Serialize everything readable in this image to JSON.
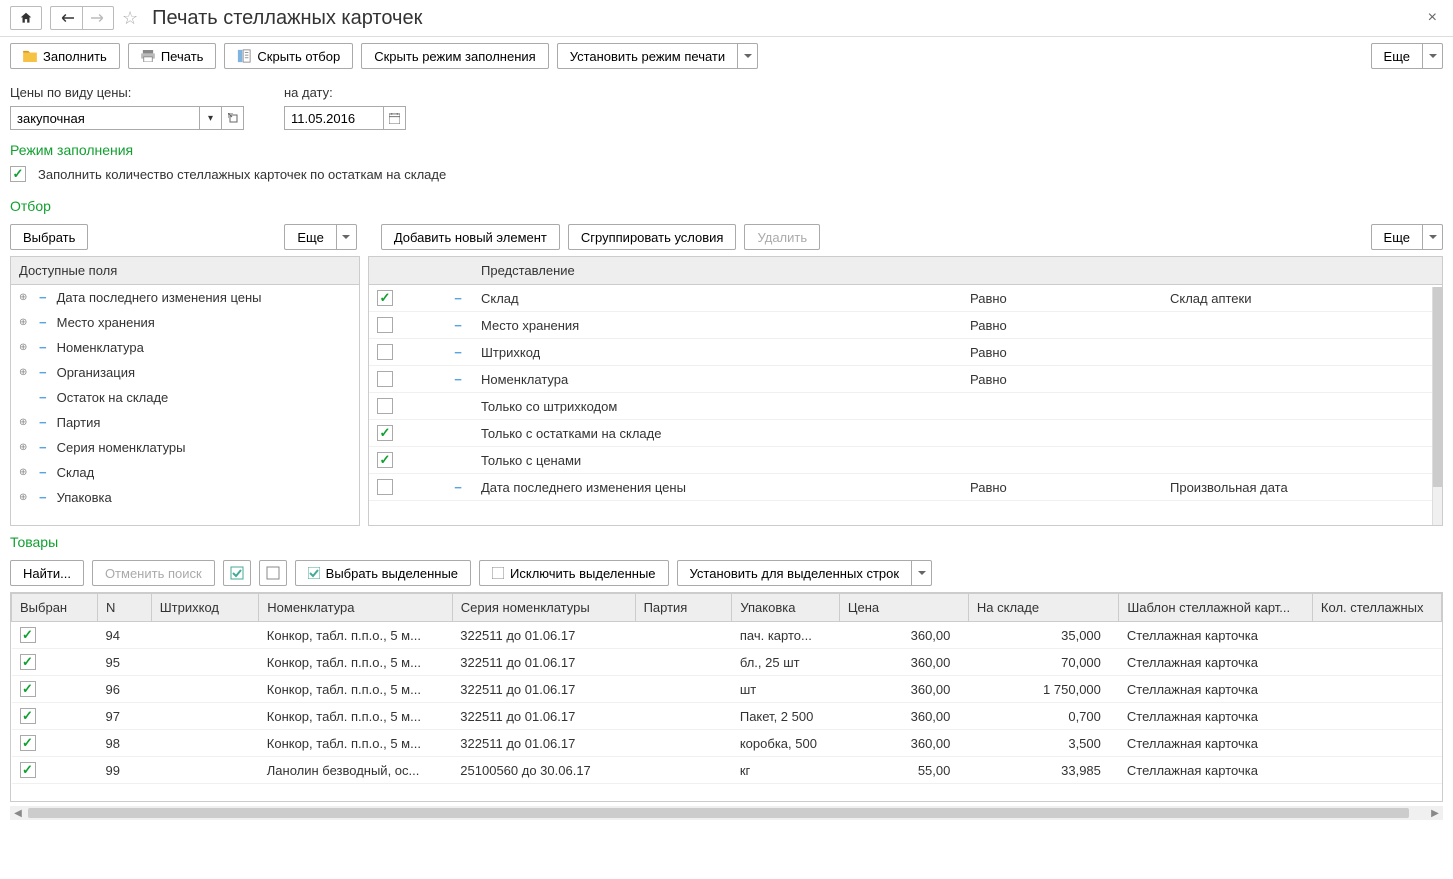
{
  "header": {
    "title": "Печать стеллажных карточек"
  },
  "toolbar": {
    "fill_label": "Заполнить",
    "print_label": "Печать",
    "hide_filter_label": "Скрыть отбор",
    "hide_fill_mode_label": "Скрыть режим заполнения",
    "set_print_mode_label": "Установить режим печати",
    "more_label": "Еще"
  },
  "form": {
    "price_type_label": "Цены по виду цены:",
    "price_type_value": "закупочная",
    "date_label": "на дату:",
    "date_value": "11.05.2016"
  },
  "fill_mode": {
    "title": "Режим заполнения",
    "checkbox_label": "Заполнить количество стеллажных карточек по остаткам на складе"
  },
  "filter": {
    "title": "Отбор",
    "select_label": "Выбрать",
    "more_label": "Еще",
    "add_element_label": "Добавить новый элемент",
    "group_conditions_label": "Сгруппировать условия",
    "delete_label": "Удалить",
    "more2_label": "Еще",
    "available_fields_header": "Доступные поля",
    "representation_header": "Представление",
    "fields": [
      {
        "expand": true,
        "label": "Дата последнего изменения цены"
      },
      {
        "expand": true,
        "label": "Место хранения"
      },
      {
        "expand": true,
        "label": "Номенклатура"
      },
      {
        "expand": true,
        "label": "Организация"
      },
      {
        "expand": false,
        "label": "Остаток на складе"
      },
      {
        "expand": true,
        "label": "Партия"
      },
      {
        "expand": true,
        "label": "Серия номенклатуры"
      },
      {
        "expand": true,
        "label": "Склад"
      },
      {
        "expand": true,
        "label": "Упаковка"
      }
    ],
    "rows": [
      {
        "checked": true,
        "has_minus": true,
        "name": "Склад",
        "op": "Равно",
        "val": "Склад аптеки"
      },
      {
        "checked": false,
        "has_minus": true,
        "name": "Место хранения",
        "op": "Равно",
        "val": ""
      },
      {
        "checked": false,
        "has_minus": true,
        "name": "Штрихкод",
        "op": "Равно",
        "val": ""
      },
      {
        "checked": false,
        "has_minus": true,
        "name": "Номенклатура",
        "op": "Равно",
        "val": ""
      },
      {
        "checked": false,
        "has_minus": false,
        "name": "Только со штрихкодом",
        "op": "",
        "val": ""
      },
      {
        "checked": true,
        "has_minus": false,
        "name": "Только с остатками на складе",
        "op": "",
        "val": ""
      },
      {
        "checked": true,
        "has_minus": false,
        "name": "Только с ценами",
        "op": "",
        "val": ""
      },
      {
        "checked": false,
        "has_minus": true,
        "name": "Дата последнего изменения цены",
        "op": "Равно",
        "val": "Произвольная дата"
      }
    ]
  },
  "products": {
    "title": "Товары",
    "find_label": "Найти...",
    "cancel_search_label": "Отменить поиск",
    "select_marked_label": "Выбрать выделенные",
    "exclude_marked_label": "Исключить выделенные",
    "set_for_marked_label": "Установить для выделенных строк",
    "columns": {
      "selected": "Выбран",
      "n": "N",
      "barcode": "Штрихкод",
      "nomenclature": "Номенклатура",
      "series": "Серия номенклатуры",
      "batch": "Партия",
      "package": "Упаковка",
      "price": "Цена",
      "in_stock": "На складе",
      "template": "Шаблон стеллажной карт...",
      "count": "Кол. стеллажных"
    },
    "rows": [
      {
        "sel": true,
        "n": "94",
        "bar": "",
        "nom": "Конкор, табл. п.п.о., 5 м...",
        "ser": "322511 до 01.06.17",
        "par": "",
        "pack": "пач. карто...",
        "price": "360,00",
        "stock": "35,000",
        "tmpl": "Стеллажная карточка"
      },
      {
        "sel": true,
        "n": "95",
        "bar": "",
        "nom": "Конкор, табл. п.п.о., 5 м...",
        "ser": "322511 до 01.06.17",
        "par": "",
        "pack": "бл., 25 шт",
        "price": "360,00",
        "stock": "70,000",
        "tmpl": "Стеллажная карточка"
      },
      {
        "sel": true,
        "n": "96",
        "bar": "",
        "nom": "Конкор, табл. п.п.о., 5 м...",
        "ser": "322511 до 01.06.17",
        "par": "",
        "pack": "шт",
        "price": "360,00",
        "stock": "1 750,000",
        "tmpl": "Стеллажная карточка"
      },
      {
        "sel": true,
        "n": "97",
        "bar": "",
        "nom": "Конкор, табл. п.п.о., 5 м...",
        "ser": "322511 до 01.06.17",
        "par": "",
        "pack": "Пакет, 2 500",
        "price": "360,00",
        "stock": "0,700",
        "tmpl": "Стеллажная карточка"
      },
      {
        "sel": true,
        "n": "98",
        "bar": "",
        "nom": "Конкор, табл. п.п.о., 5 м...",
        "ser": "322511 до 01.06.17",
        "par": "",
        "pack": "коробка, 500",
        "price": "360,00",
        "stock": "3,500",
        "tmpl": "Стеллажная карточка"
      },
      {
        "sel": true,
        "n": "99",
        "bar": "",
        "nom": "Ланолин безводный, ос...",
        "ser": "25100560 до 30.06.17",
        "par": "",
        "pack": "кг",
        "price": "55,00",
        "stock": "33,985",
        "tmpl": "Стеллажная карточка"
      }
    ]
  }
}
